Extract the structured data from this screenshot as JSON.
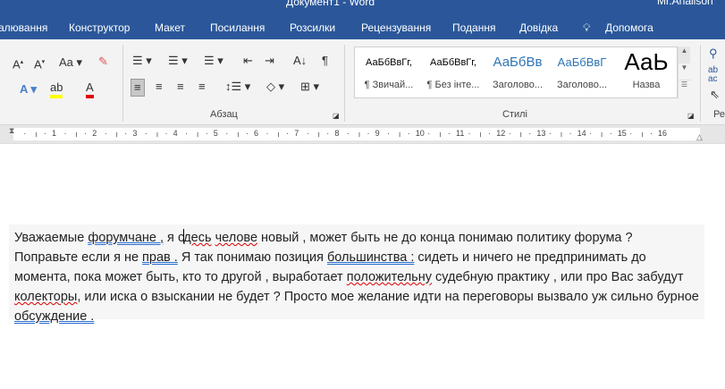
{
  "window": {
    "title": "Документ1 - Word",
    "user": "Mr.Analison"
  },
  "tabs": [
    "алювання",
    "Конструктор",
    "Макет",
    "Посилання",
    "Розсилки",
    "Рецензування",
    "Подання",
    "Довідка",
    "Допомога"
  ],
  "ribbon": {
    "groups": {
      "paragraph": "Абзац",
      "styles": "Стилі",
      "editing": "Ре"
    },
    "font_case": "Aa",
    "styles": [
      {
        "preview": "АаБбВвГг,",
        "name": "¶ Звичай..."
      },
      {
        "preview": "АаБбВвГг,",
        "name": "¶ Без інте..."
      },
      {
        "preview": "АаБбВв",
        "name": "Заголово..."
      },
      {
        "preview": "АаБбВвГ",
        "name": "Заголово..."
      },
      {
        "preview": "АаЬ",
        "name": "Назва"
      }
    ],
    "colors": {
      "highlight": "#ffff00",
      "font_color": "#e00000",
      "accent": "#2b579a"
    }
  },
  "ruler": {
    "numbers": [
      "1",
      "2",
      "3",
      "4",
      "5",
      "6",
      "7",
      "8",
      "9",
      "10",
      "11",
      "12",
      "13",
      "14",
      "15",
      "16"
    ]
  },
  "document": {
    "segments": [
      {
        "t": "Уважаемые "
      },
      {
        "t": "форумчане ,",
        "c": "gr"
      },
      {
        "t": " я "
      },
      {
        "t": "с"
      },
      {
        "cursor": true
      },
      {
        "t": "десь",
        "c": "sp"
      },
      {
        "t": " "
      },
      {
        "t": "челове",
        "c": "sp"
      },
      {
        "t": " новый , может быть не до конца понимаю политику форума ? Поправьте если я не "
      },
      {
        "t": "прав .",
        "c": "gr"
      },
      {
        "t": " Я так понимаю позиция "
      },
      {
        "t": "большинства :",
        "c": "gr"
      },
      {
        "t": " сидеть и ничего не предпринимать до момента, пока может быть, кто то другой ,  выработает "
      },
      {
        "t": "положительну",
        "c": "sp"
      },
      {
        "t": " судебную практику , или про Вас забудут "
      },
      {
        "t": "колекторы",
        "c": "sp"
      },
      {
        "t": ", или иска о взыскании не будет ? Просто мое желание идти на переговоры вызвало уж сильно бурное "
      },
      {
        "t": "обсуждение .",
        "c": "gr"
      }
    ]
  }
}
